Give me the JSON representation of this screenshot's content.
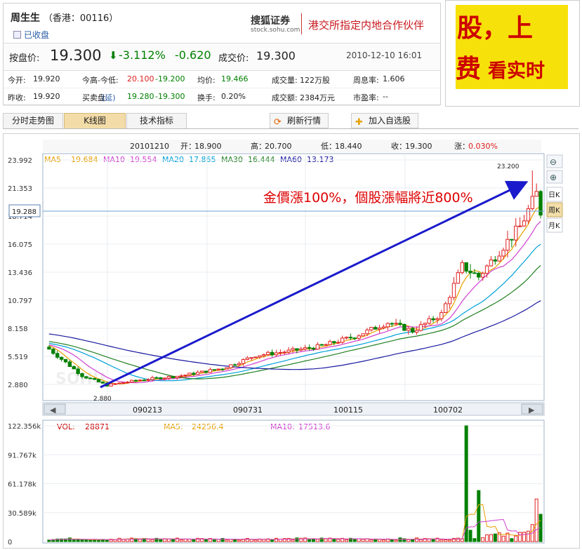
{
  "quote": {
    "name": "周生生",
    "market": "（香港：00116）",
    "status": "已收盘",
    "brand": "搜狐证券",
    "brand_site": "stock.sohu.com",
    "partner": "港交所指定内地合作伙伴",
    "price_label": "按盘价:",
    "price": "19.300",
    "change_pct": "-3.112%",
    "change": "-0.620",
    "trade_label": "成交价:",
    "trade_price": "19.300",
    "datetime": "2010-12-10 16:01",
    "open_label": "今开:",
    "open": "19.920",
    "hilo_label": "今高-今低:",
    "high": "20.100",
    "low": "-19.200",
    "avg_label": "均价:",
    "avg": "19.466",
    "vol_label": "成交量:",
    "vol": "122万股",
    "turnover_label": "周息率:",
    "turnover": "1.606",
    "prev_label": "昨收:",
    "prev": "19.920",
    "bidask_label": "买卖盘",
    "bidask_sub": "(延)",
    "bid": "19.280",
    "ask": "-19.300",
    "swap_label": "换手:",
    "swap": "0.20%",
    "amount_label": "成交额:",
    "amount": "2384万元",
    "pe_label": "市盈率:",
    "pe": "--"
  },
  "ad": {
    "line1": "股，上",
    "line2": "费",
    "line3": "看实时"
  },
  "tabs": [
    "分时走势图",
    "K线图",
    "技术指标"
  ],
  "buttons": {
    "refresh": "刷新行情",
    "add": "加入自选股"
  },
  "colors": {
    "up": "#e02020",
    "down": "#008000",
    "accent": "#2a5ca8",
    "arrow": "#1a1acc",
    "annotation": "#dd0000"
  },
  "kinfo": {
    "date": "20101210",
    "open_label": "开：",
    "open": "18.900",
    "high_label": "高：",
    "high": "20.700",
    "low_label": "低：",
    "low": "18.440",
    "close_label": "收：",
    "close": "19.300",
    "chg_label": "涨：",
    "chg": "0.030%"
  },
  "ma": [
    {
      "name": "MA5",
      "value": "19.684",
      "color": "#e8a000"
    },
    {
      "name": "MA10",
      "value": "19.554",
      "color": "#d040d0"
    },
    {
      "name": "MA20",
      "value": "17.865",
      "color": "#00a0d8"
    },
    {
      "name": "MA30",
      "value": "16.444",
      "color": "#208020"
    },
    {
      "name": "MA60",
      "value": "13.173",
      "color": "#1818a0"
    }
  ],
  "side_buttons": [
    "日K",
    "周K",
    "月K"
  ],
  "annotation": "金價漲100%，個股漲幅將近800%",
  "chart_data": [
    {
      "type": "candlestick",
      "yticks": [
        "23.992",
        "21.353",
        "18.714",
        "16.075",
        "13.436",
        "10.797",
        "8.158",
        "5.519",
        "2.880"
      ],
      "ylim": [
        2.88,
        23.992
      ],
      "cursor_value": "19.288",
      "max_label": "23.200",
      "min_label": "2.880",
      "xticks": [
        "090213",
        "090731",
        "100115",
        "100702"
      ],
      "watermark": "SOHU"
    },
    {
      "type": "bar",
      "legend": [
        {
          "name": "VOL:",
          "value": "28871",
          "color": "#cc0000"
        },
        {
          "name": "MA5:",
          "value": "24256.4",
          "color": "#e8a000"
        },
        {
          "name": "MA10:",
          "value": "17513.6",
          "color": "#d040d0"
        }
      ],
      "yticks": [
        "122.356k",
        "91.767k",
        "61.178k",
        "30.589k",
        "0"
      ],
      "ylim": [
        0,
        122356
      ]
    }
  ]
}
